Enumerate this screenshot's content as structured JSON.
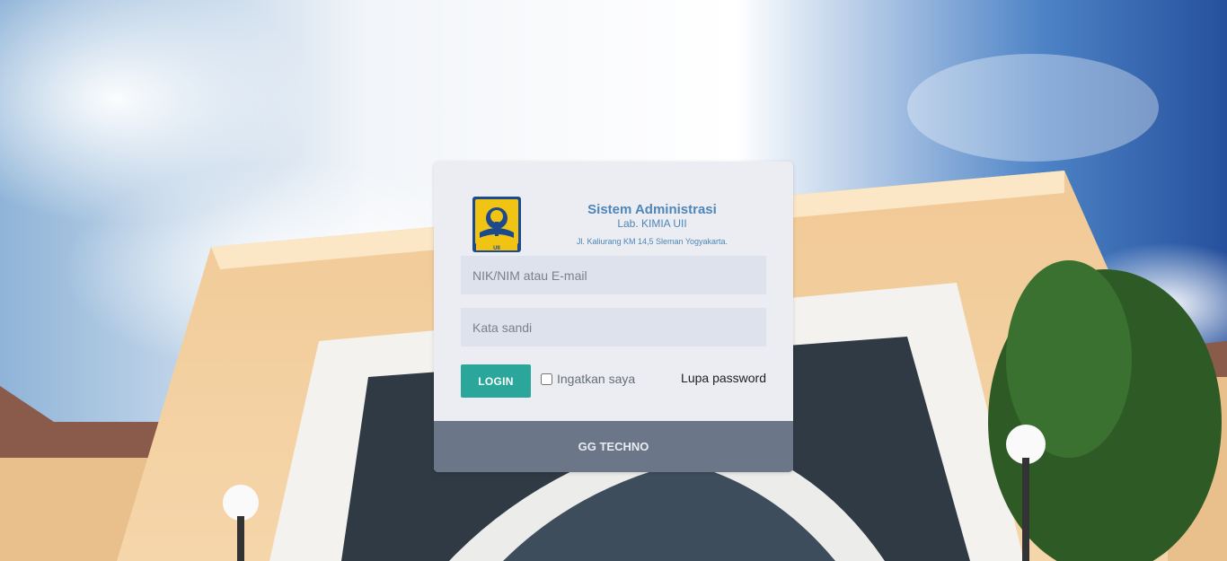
{
  "header": {
    "title": "Sistem Administrasi",
    "subtitle": "Lab. KIMIA UII",
    "address": "Jl. Kaliurang KM 14,5 Sleman Yogyakarta."
  },
  "form": {
    "username_placeholder": "NIK/NIM atau E-mail",
    "username_value": "",
    "password_placeholder": "Kata sandi",
    "password_value": "",
    "login_label": "LOGIN",
    "remember_label": "Ingatkan saya",
    "remember_checked": false,
    "forgot_label": "Lupa password"
  },
  "footer": {
    "label": "GG TECHNO"
  },
  "colors": {
    "accent": "#2aa79a",
    "heading": "#4f86b8",
    "footer_bg": "#6b7788"
  },
  "icons": {
    "logo": "uii-emblem-icon"
  }
}
